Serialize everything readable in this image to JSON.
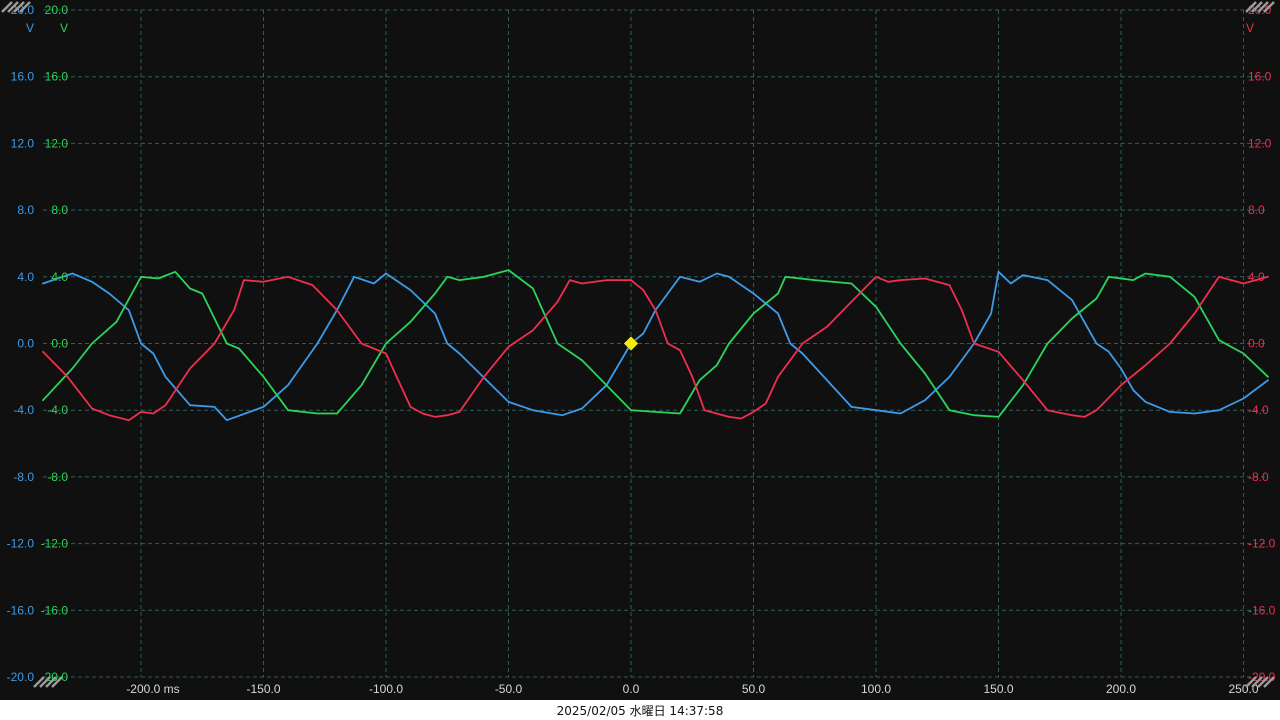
{
  "status_bar": {
    "timestamp": "2025/02/05 水曜日 14:37:58"
  },
  "colors": {
    "background": "#101010",
    "grid": "#2f6f66",
    "blue": "#3d9be9",
    "green": "#2bd45a",
    "red": "#ef2f4f",
    "trigger": "#f2ea10",
    "x_tick": "#d8d8d8"
  },
  "icons": {
    "corner_markers": "hatched-corner-icon",
    "trigger_marker": "diamond-icon"
  },
  "chart_data": {
    "type": "line",
    "title": "",
    "xunit": "ms",
    "xlim": [
      -240,
      260
    ],
    "ylim": [
      -20,
      20
    ],
    "grid": true,
    "x_ticks": [
      "-200.0 ms",
      "-150.0",
      "-100.0",
      "-50.0",
      "0.0",
      "50.0",
      "100.0",
      "150.0",
      "200.0",
      "250.0"
    ],
    "x_tick_values": [
      -200,
      -150,
      -100,
      -50,
      0,
      50,
      100,
      150,
      200,
      250
    ],
    "y_tick_values": [
      20,
      16,
      12,
      8,
      4,
      0,
      -4,
      -8,
      -12,
      -16,
      -20
    ],
    "y_axes": [
      {
        "name": "blue",
        "side": "left",
        "color": "#3d9be9",
        "unit": "V",
        "ticks": [
          "20.0",
          "16.0",
          "12.0",
          "8.0",
          "4.0",
          "0.0",
          "-4.0",
          "-8.0",
          "-12.0",
          "-16.0",
          "-20.0"
        ]
      },
      {
        "name": "green",
        "side": "left",
        "color": "#2bd45a",
        "unit": "V",
        "ticks": [
          "20.0",
          "16.0",
          "12.0",
          "8.0",
          "4.0",
          "0.0",
          "-4.0",
          "-8.0",
          "-12.0",
          "-16.0",
          "-20.0"
        ]
      },
      {
        "name": "red",
        "side": "right",
        "color": "#ef2f4f",
        "unit": "V",
        "ticks": [
          "20.0",
          "16.0",
          "12.0",
          "8.0",
          "4.0",
          "0.0",
          "-4.0",
          "-8.0",
          "-12.0",
          "-16.0",
          "-20.0"
        ]
      }
    ],
    "trigger": {
      "x": 0,
      "y": 0
    },
    "series": [
      {
        "color": "#3d9be9",
        "x": [
          -240,
          -228,
          -220,
          -213,
          -205,
          -200,
          -195,
          -190,
          -180,
          -170,
          -165,
          -150,
          -140,
          -128,
          -120,
          -113,
          -105,
          -100,
          -90,
          -80,
          -75,
          -70,
          -50,
          -40,
          -28,
          -20,
          -10,
          0,
          5,
          10,
          20,
          28,
          35,
          40,
          50,
          60,
          65,
          70,
          90,
          100,
          110,
          120,
          130,
          140,
          147,
          150,
          155,
          160,
          170,
          180,
          190,
          195,
          200,
          205,
          210,
          220,
          230,
          240,
          250,
          260
        ],
        "y": [
          3.6,
          4.2,
          3.7,
          3.0,
          2.0,
          0.0,
          -0.6,
          -2.0,
          -3.7,
          -3.8,
          -4.6,
          -3.8,
          -2.5,
          0.0,
          2.0,
          4.0,
          3.6,
          4.2,
          3.2,
          1.8,
          0.0,
          -0.6,
          -3.5,
          -4.0,
          -4.3,
          -3.9,
          -2.5,
          0.0,
          0.6,
          2.0,
          4.0,
          3.7,
          4.2,
          4.0,
          3.0,
          1.8,
          0.0,
          -0.6,
          -3.8,
          -4.0,
          -4.2,
          -3.4,
          -2.0,
          0.0,
          1.8,
          4.3,
          3.6,
          4.1,
          3.8,
          2.6,
          0.0,
          -0.5,
          -1.5,
          -2.8,
          -3.5,
          -4.1,
          -4.2,
          -4.0,
          -3.3,
          -2.2
        ]
      },
      {
        "color": "#2bd45a",
        "x": [
          -240,
          -228,
          -220,
          -210,
          -200,
          -193,
          -186,
          -180,
          -175,
          -170,
          -165,
          -160,
          -150,
          -140,
          -128,
          -120,
          -110,
          -100,
          -90,
          -80,
          -75,
          -70,
          -60,
          -50,
          -40,
          -30,
          -20,
          -10,
          0,
          10,
          20,
          28,
          35,
          40,
          50,
          60,
          63,
          75,
          90,
          100,
          110,
          120,
          130,
          140,
          150,
          160,
          170,
          180,
          190,
          195,
          205,
          210,
          220,
          230,
          240,
          250,
          260
        ],
        "y": [
          -3.4,
          -1.5,
          0.0,
          1.3,
          4.0,
          3.9,
          4.3,
          3.3,
          3.0,
          1.5,
          0.0,
          -0.3,
          -2.0,
          -4.0,
          -4.2,
          -4.2,
          -2.5,
          0.0,
          1.3,
          3.0,
          4.0,
          3.8,
          4.0,
          4.4,
          3.3,
          0.0,
          -1.0,
          -2.5,
          -4.0,
          -4.1,
          -4.2,
          -2.2,
          -1.3,
          0.0,
          1.8,
          3.0,
          4.0,
          3.8,
          3.6,
          2.2,
          0.0,
          -1.8,
          -4.0,
          -4.3,
          -4.4,
          -2.5,
          0.0,
          1.5,
          2.7,
          4.0,
          3.8,
          4.2,
          4.0,
          2.8,
          0.2,
          -0.6,
          -2.0
        ]
      },
      {
        "color": "#ef2f4f",
        "x": [
          -240,
          -230,
          -220,
          -213,
          -205,
          -200,
          -195,
          -190,
          -180,
          -170,
          -162,
          -158,
          -150,
          -140,
          -130,
          -120,
          -110,
          -100,
          -90,
          -85,
          -80,
          -75,
          -70,
          -60,
          -50,
          -40,
          -30,
          -25,
          -20,
          -10,
          0,
          5,
          10,
          15,
          20,
          25,
          30,
          40,
          45,
          50,
          55,
          60,
          70,
          80,
          90,
          100,
          105,
          110,
          120,
          130,
          135,
          140,
          150,
          160,
          170,
          180,
          185,
          190,
          200,
          210,
          220,
          230,
          240,
          250,
          260
        ],
        "y": [
          -0.5,
          -2.0,
          -3.9,
          -4.3,
          -4.6,
          -4.1,
          -4.2,
          -3.7,
          -1.5,
          0.0,
          2.0,
          3.8,
          3.7,
          4.0,
          3.5,
          2.0,
          0.0,
          -0.6,
          -3.8,
          -4.2,
          -4.4,
          -4.3,
          -4.1,
          -2.0,
          -0.2,
          0.8,
          2.5,
          3.8,
          3.6,
          3.8,
          3.8,
          3.2,
          2.0,
          0.0,
          -0.4,
          -2.0,
          -4.0,
          -4.4,
          -4.5,
          -4.1,
          -3.6,
          -2.0,
          0.0,
          1.0,
          2.5,
          4.0,
          3.7,
          3.8,
          3.9,
          3.5,
          2.0,
          0.0,
          -0.5,
          -2.2,
          -4.0,
          -4.3,
          -4.4,
          -4.0,
          -2.5,
          -1.3,
          0.0,
          1.8,
          4.0,
          3.6,
          4.0
        ]
      }
    ]
  }
}
